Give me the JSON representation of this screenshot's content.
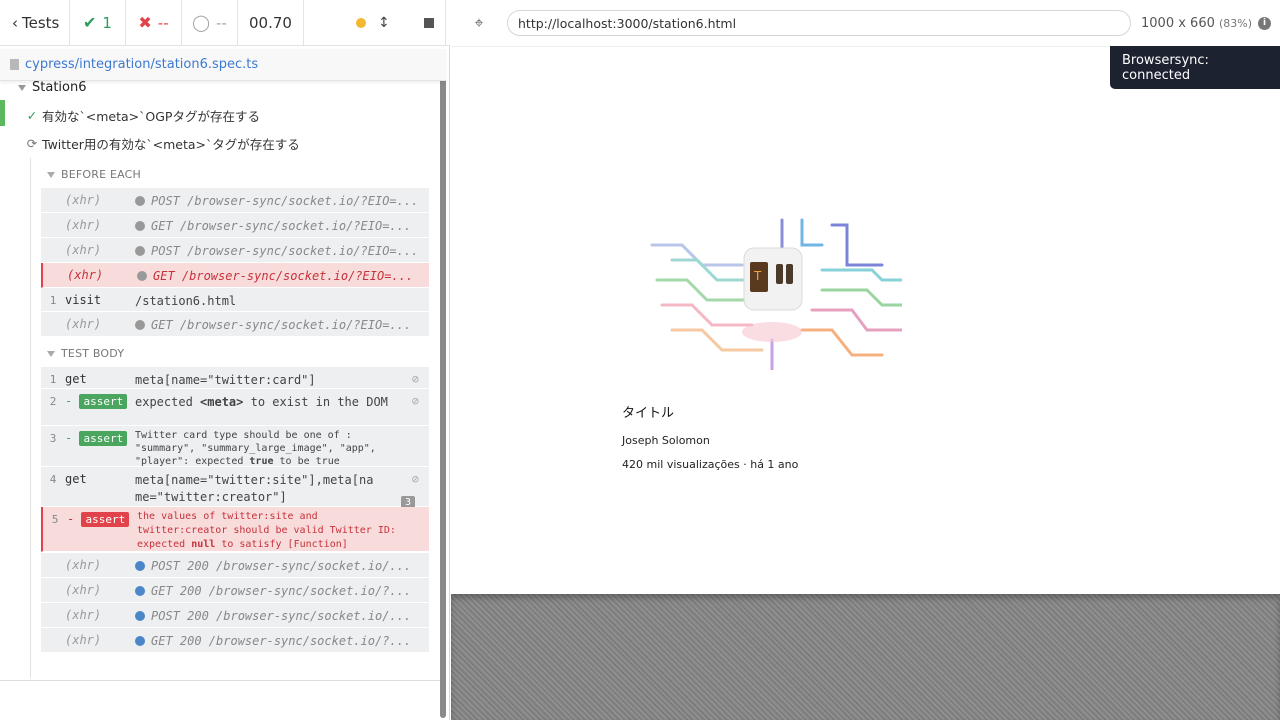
{
  "stats": {
    "tests_label": "Tests",
    "passed": "1",
    "failed": "--",
    "pending": "--",
    "duration": "00.70"
  },
  "spec": {
    "path": "cypress/integration/station6.spec.ts"
  },
  "suite": {
    "title": "Station6",
    "tests": [
      {
        "title": "有効な`<meta>`OGPタグが存在する",
        "state": "passed"
      },
      {
        "title": "Twitter用の有効な`<meta>`タグが存在する",
        "state": "running"
      }
    ]
  },
  "before_each": {
    "title": "BEFORE EACH",
    "commands": [
      {
        "name": "(xhr)",
        "msg": "POST /browser-sync/socket.io/?EIO=..."
      },
      {
        "name": "(xhr)",
        "msg": "GET /browser-sync/socket.io/?EIO=..."
      },
      {
        "name": "(xhr)",
        "msg": "POST /browser-sync/socket.io/?EIO=..."
      },
      {
        "name": "(xhr)",
        "msg": "GET /browser-sync/socket.io/?EIO=..."
      },
      {
        "num": "1",
        "name": "visit",
        "msg": "/station6.html"
      },
      {
        "name": "(xhr)",
        "msg": "GET /browser-sync/socket.io/?EIO=..."
      }
    ]
  },
  "test_body": {
    "title": "TEST BODY",
    "commands": [
      {
        "num": "1",
        "name": "get",
        "msg": "meta[name=\"twitter:card\"]"
      },
      {
        "num": "2",
        "name": "assert",
        "msg_a": "expected",
        "msg_b": "<meta>",
        "msg_c": "to exist in the DOM"
      },
      {
        "num": "3",
        "name": "assert",
        "msg_a": "Twitter card type should be one of :",
        "msg_b": "\"summary\", \"summary_large_image\", \"app\",",
        "msg_c": "\"player\": expected",
        "msg_d": "true",
        "msg_e": "to be true"
      },
      {
        "num": "4",
        "name": "get",
        "msg_a": "meta[name=\"twitter:site\"],meta[na",
        "msg_b": "me=\"twitter:creator\"]",
        "count": "3"
      },
      {
        "num": "5",
        "name": "assert",
        "msg_a": "the values of twitter:site and",
        "msg_b": "twitter:creator should be valid Twitter ID:",
        "msg_c": "expected",
        "msg_d": "null",
        "msg_e": "to satisfy [Function]"
      },
      {
        "name": "(xhr)",
        "msg": "POST 200 /browser-sync/socket.io/..."
      },
      {
        "name": "(xhr)",
        "msg": "GET 200 /browser-sync/socket.io/?..."
      },
      {
        "name": "(xhr)",
        "msg": "POST 200 /browser-sync/socket.io/..."
      },
      {
        "name": "(xhr)",
        "msg": "GET 200 /browser-sync/socket.io/?..."
      }
    ]
  },
  "aut": {
    "url": "http://localhost:3000/station6.html",
    "viewport": "1000 x 660",
    "scale": "(83%)",
    "toast": "Browsersync: connected",
    "page": {
      "title": "タイトル",
      "author": "Joseph Solomon",
      "meta": "420 mil visualizações · há 1 ano"
    }
  },
  "colors": {
    "pass": "#2e9d5b",
    "fail": "#e0434a",
    "link": "#3c79d0",
    "toast_bg": "#1c2230"
  },
  "icons": [
    "chevron-left-icon",
    "check-icon",
    "x-icon",
    "spinner-icon",
    "running-dot-icon",
    "resize-icon",
    "stop-icon",
    "file-icon",
    "selector-crosshair-icon",
    "info-icon",
    "eye-slash-icon"
  ]
}
